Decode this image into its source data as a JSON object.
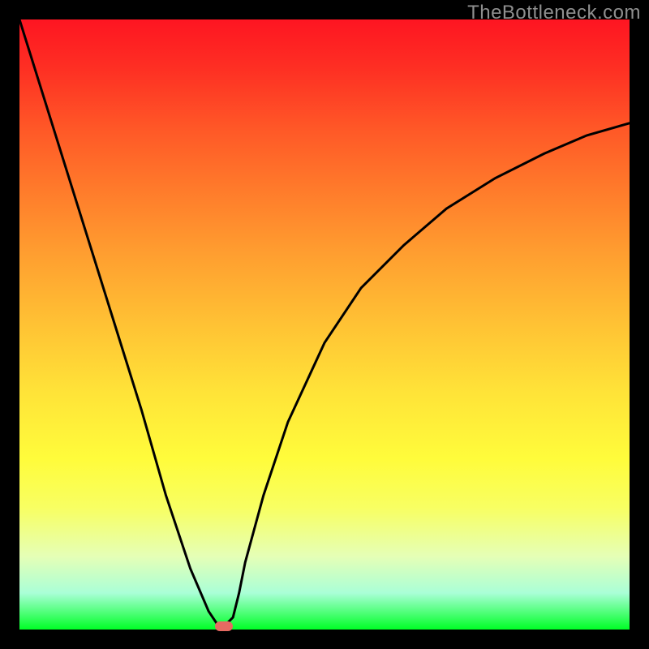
{
  "watermark": "TheBottleneck.com",
  "colors": {
    "frame_border": "#000000",
    "curve": "#000000",
    "marker": "#e66a62",
    "gradient_top": "#fe1522",
    "gradient_bottom": "#00ff27"
  },
  "chart_data": {
    "type": "line",
    "title": "",
    "xlabel": "",
    "ylabel": "",
    "x": [
      0.0,
      0.05,
      0.1,
      0.15,
      0.2,
      0.24,
      0.28,
      0.31,
      0.33,
      0.35,
      0.36,
      0.37,
      0.4,
      0.44,
      0.5,
      0.56,
      0.63,
      0.7,
      0.78,
      0.86,
      0.93,
      1.0
    ],
    "values": [
      1.0,
      0.84,
      0.68,
      0.52,
      0.36,
      0.22,
      0.1,
      0.03,
      0.0,
      0.02,
      0.06,
      0.11,
      0.22,
      0.34,
      0.47,
      0.56,
      0.63,
      0.69,
      0.74,
      0.78,
      0.81,
      0.83
    ],
    "xlim": [
      0,
      1
    ],
    "ylim": [
      0,
      1
    ],
    "marker": {
      "x": 0.335,
      "y": 0.0
    },
    "note": "Values are normalized to [0,1] in both axes. Vertical gradient background runs red(top)→green(bottom). Single black V-shaped curve touching bottom near x≈0.33; small pink pill marker at the minimum."
  }
}
